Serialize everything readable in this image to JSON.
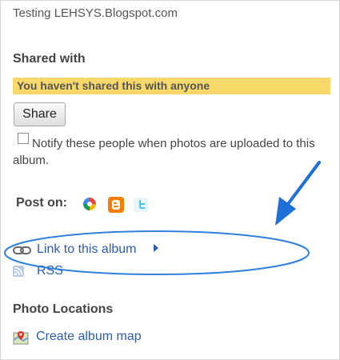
{
  "account": {
    "title": "Testing LEHSYS.Blogspot.com"
  },
  "shared": {
    "heading": "Shared with",
    "banner": "You haven't shared this with anyone",
    "share_button": "Share",
    "notify_label": "Notify these people when photos are uploaded to this album.",
    "notify_checked": false
  },
  "post": {
    "label": "Post on:",
    "services": [
      {
        "name": "Buzz",
        "icon": "buzz-icon"
      },
      {
        "name": "Blogger",
        "icon": "blogger-icon"
      },
      {
        "name": "Twitter",
        "icon": "twitter-icon"
      }
    ]
  },
  "links": {
    "album_link": "Link to this album",
    "rss": "RSS"
  },
  "locations": {
    "heading": "Photo Locations",
    "create_map": "Create album map"
  },
  "annotations": {
    "highlight_color": "#2f7fdc",
    "arrow_color": "#1f6fd8"
  },
  "colors": {
    "banner_bg": "#f9d86a",
    "link": "#2a5db0",
    "blogger": "#f57d00"
  }
}
